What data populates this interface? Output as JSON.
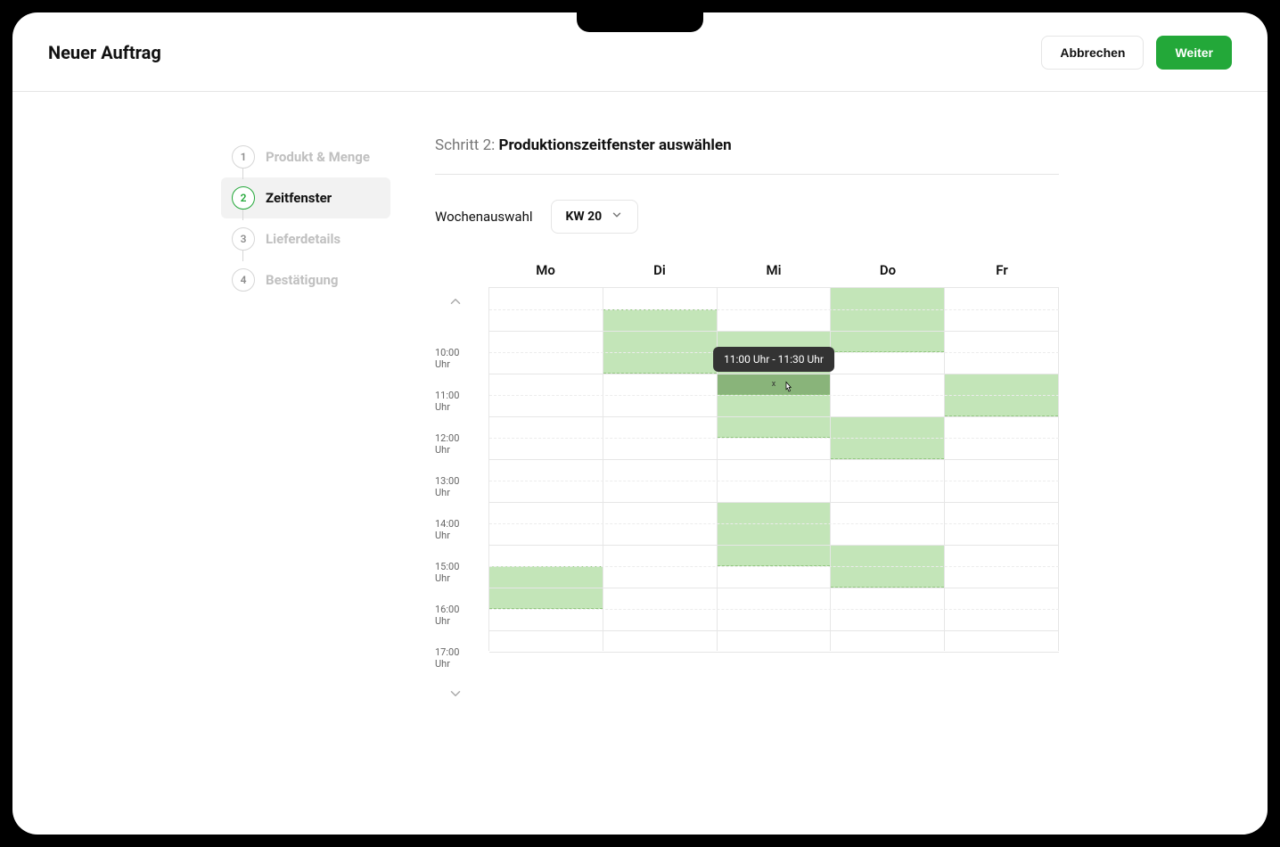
{
  "colors": {
    "accent": "#23a839",
    "slot": "#c3e5b8",
    "slot_selected": "#89b47a"
  },
  "header": {
    "title": "Neuer Auftrag",
    "cancel_label": "Abbrechen",
    "next_label": "Weiter"
  },
  "steps": [
    {
      "num": "1",
      "label": "Produkt & Menge",
      "state": "done"
    },
    {
      "num": "2",
      "label": "Zeitfenster",
      "state": "active"
    },
    {
      "num": "3",
      "label": "Lieferdetails",
      "state": "future"
    },
    {
      "num": "4",
      "label": "Bestätigung",
      "state": "future"
    }
  ],
  "main": {
    "step_prefix": "Schritt 2:",
    "step_title": "Produktionszeitfenster auswählen",
    "week_label": "Wochenauswahl",
    "week_value": "KW 20"
  },
  "calendar": {
    "days": [
      "Mo",
      "Di",
      "Mi",
      "Do",
      "Fr"
    ],
    "range_start_hour": 9,
    "range_end_hour": 17.5,
    "hour_labels": [
      "10:00 Uhr",
      "11:00 Uhr",
      "12:00 Uhr",
      "13:00 Uhr",
      "14:00 Uhr",
      "15:00 Uhr",
      "16:00 Uhr",
      "17:00 Uhr"
    ],
    "slots": [
      {
        "day": 0,
        "from": 15.5,
        "to": 16.5
      },
      {
        "day": 1,
        "from": 9.5,
        "to": 11.0
      },
      {
        "day": 2,
        "from": 10.0,
        "to": 12.5
      },
      {
        "day": 2,
        "from": 14.0,
        "to": 15.5
      },
      {
        "day": 3,
        "from": 9.0,
        "to": 10.5,
        "open_top": true
      },
      {
        "day": 3,
        "from": 12.0,
        "to": 13.0
      },
      {
        "day": 3,
        "from": 15.0,
        "to": 16.0
      },
      {
        "day": 4,
        "from": 11.0,
        "to": 12.0
      }
    ],
    "selected": {
      "day": 2,
      "from": 11.0,
      "to": 11.5
    },
    "tooltip": "11:00 Uhr - 11:30 Uhr"
  }
}
